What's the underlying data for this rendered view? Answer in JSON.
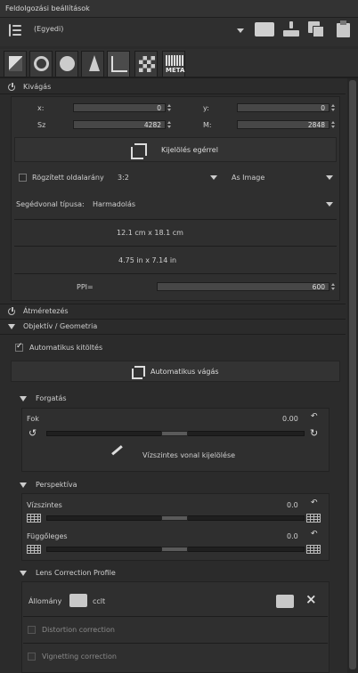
{
  "header": {
    "title": "Feldolgozási beállítások"
  },
  "profile": {
    "selected": "(Egyedi)"
  },
  "tabs": [
    "exposure",
    "detail",
    "color",
    "wavelet",
    "transform",
    "raw",
    "META"
  ],
  "sections": {
    "crop": {
      "title": "Kivágás",
      "x_label": "x:",
      "x_value": "0",
      "y_label": "y:",
      "y_value": "0",
      "w_label": "Sz",
      "w_value": "4282",
      "h_label": "M:",
      "h_value": "2848",
      "select_button": "Kijelölés egérrel",
      "fixed_ratio_label": "Rögzített oldalarány",
      "ratio_value": "3:2",
      "orientation_value": "As Image",
      "guide_label": "Segédvonal típusa:",
      "guide_value": "Harmadolás",
      "size_cm": "12.1 cm x 18.1 cm",
      "size_in": "4.75 in x 7.14 in",
      "ppi_label": "PPI=",
      "ppi_value": "600"
    },
    "resize": {
      "title": "Átméretezés"
    },
    "lens_geometry": {
      "title": "Objektív / Geometria",
      "autofill_label": "Automatikus kitöltés",
      "autocrop_button": "Automatikus vágás"
    },
    "rotate": {
      "title": "Forgatás",
      "degree_label": "Fok",
      "degree_value": "0.00",
      "select_straight_button": "Vízszintes vonal kijelölése"
    },
    "perspective": {
      "title": "Perspektíva",
      "horizontal_label": "Vízszintes",
      "horizontal_value": "0.0",
      "vertical_label": "Függőleges",
      "vertical_value": "0.0"
    },
    "lcp": {
      "title": "Lens Correction Profile",
      "file_label": "Állomány",
      "file_value": "cclt",
      "distortion_label": "Distortion correction",
      "vignetting_label": "Vignetting correction"
    }
  }
}
